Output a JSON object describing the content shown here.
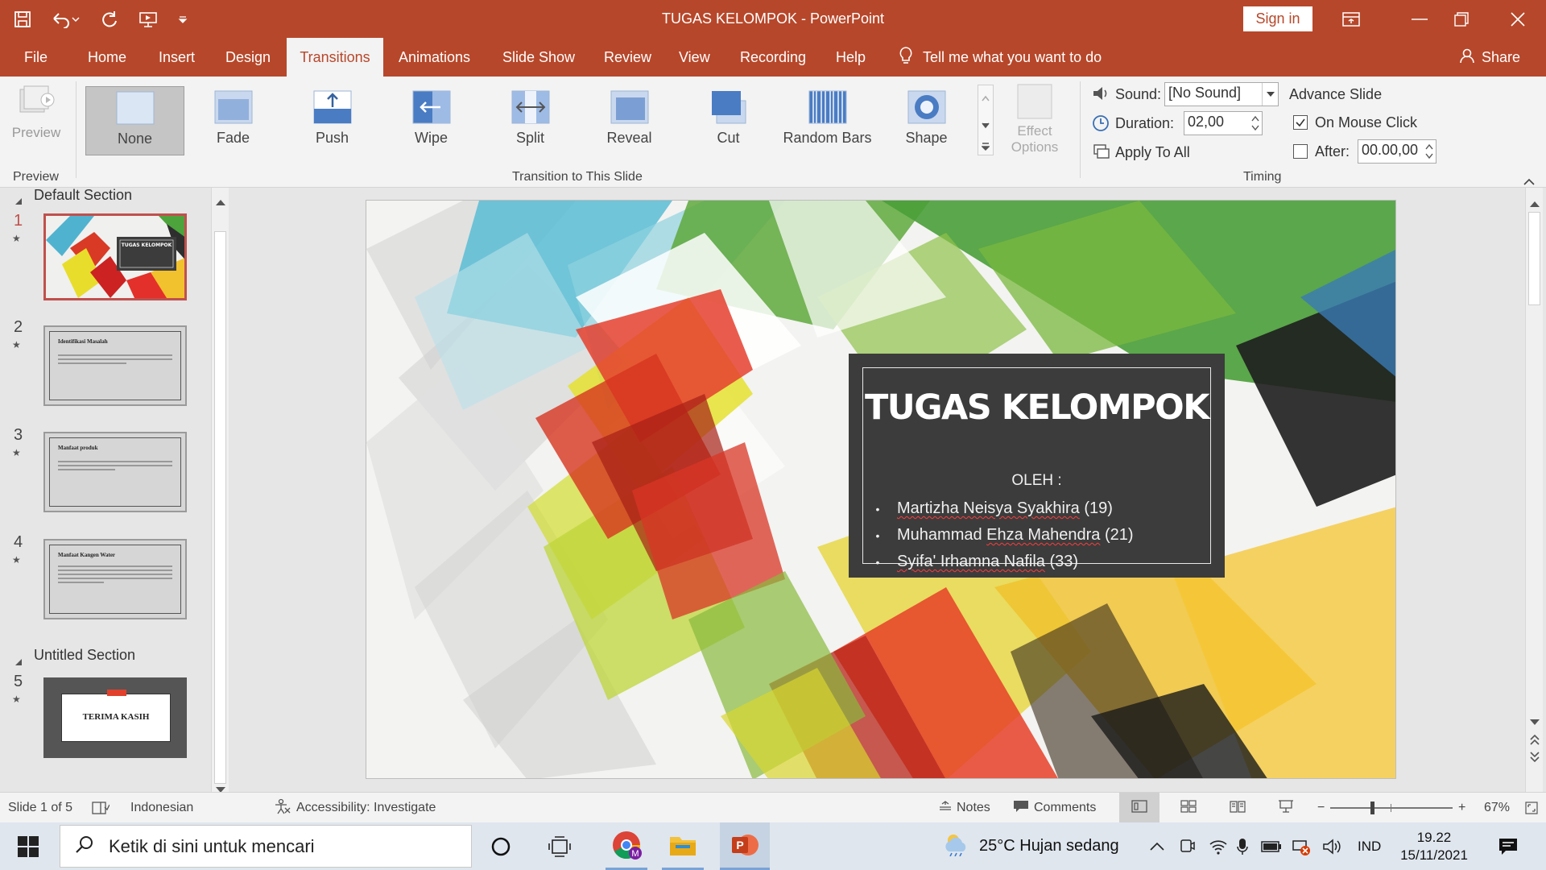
{
  "window": {
    "title": "TUGAS KELOMPOK  -  PowerPoint",
    "sign_in": "Sign in"
  },
  "tabs": {
    "file": "File",
    "home": "Home",
    "insert": "Insert",
    "design": "Design",
    "transitions": "Transitions",
    "animations": "Animations",
    "slide_show": "Slide Show",
    "review": "Review",
    "view": "View",
    "recording": "Recording",
    "help": "Help",
    "tell_me": "Tell me what you want to do",
    "share": "Share"
  },
  "ribbon": {
    "preview": "Preview",
    "preview_group": "Preview",
    "transitions": {
      "none": "None",
      "fade": "Fade",
      "push": "Push",
      "wipe": "Wipe",
      "split": "Split",
      "reveal": "Reveal",
      "cut": "Cut",
      "random_bars": "Random Bars",
      "shape": "Shape"
    },
    "effect_options_line1": "Effect",
    "effect_options_line2": "Options",
    "transition_group": "Transition to This Slide",
    "sound_label": "Sound:",
    "sound_value": "[No Sound]",
    "duration_label": "Duration:",
    "duration_value": "02,00",
    "apply_all": "Apply To All",
    "advance_slide": "Advance Slide",
    "on_mouse_click": "On Mouse Click",
    "on_mouse_click_checked": true,
    "after_label": "After:",
    "after_value": "00.00,00",
    "after_checked": false,
    "timing_group": "Timing"
  },
  "slide_panel": {
    "section_default": "Default Section",
    "section_untitled": "Untitled Section",
    "num1": "1",
    "num2": "2",
    "num3": "3",
    "num4": "4",
    "num5": "5",
    "thumb1_title": "TUGAS KELOMPOK",
    "thumb2_title": "Identifikasi Masalah",
    "thumb3_title": "Manfaat produk",
    "thumb4_title": "Manfaat Kangen Water",
    "thumb5_title": "TERIMA KASIH"
  },
  "slide": {
    "title": "TUGAS KELOMPOK",
    "oleh": "OLEH :",
    "member1_name": "Martizha Neisya Syakhira",
    "member1_num": "(19)",
    "member2_first": "Muhammad",
    "member2_mid": "Ehza Mahendra",
    "member2_num": "(21)",
    "member3_name": "Syifa' Irhamna Nafila",
    "member3_num": "(33)"
  },
  "status": {
    "slide_info": "Slide 1 of 5",
    "language": "Indonesian",
    "accessibility": "Accessibility: Investigate",
    "notes": "Notes",
    "comments": "Comments",
    "zoom_minus": "−",
    "zoom_plus": "+",
    "zoom": "67%"
  },
  "taskbar": {
    "search_placeholder": "Ketik di sini untuk mencari",
    "weather": "25°C  Hujan sedang",
    "lang": "IND",
    "time": "19.22",
    "date": "15/11/2021"
  },
  "colors": {
    "accent": "#b7472a",
    "ribbon_bg": "#f3f3f3",
    "selected_thumb_border": "#c0504d",
    "title_box": "#3c3c3c"
  }
}
